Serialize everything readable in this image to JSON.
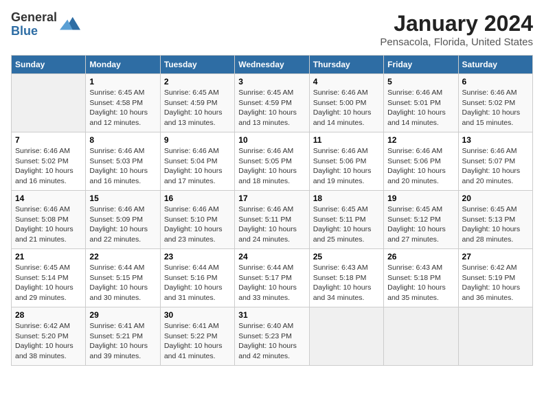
{
  "logo": {
    "general": "General",
    "blue": "Blue"
  },
  "title": "January 2024",
  "subtitle": "Pensacola, Florida, United States",
  "days_header": [
    "Sunday",
    "Monday",
    "Tuesday",
    "Wednesday",
    "Thursday",
    "Friday",
    "Saturday"
  ],
  "weeks": [
    [
      {
        "day": "",
        "content": ""
      },
      {
        "day": "1",
        "content": "Sunrise: 6:45 AM\nSunset: 4:58 PM\nDaylight: 10 hours\nand 12 minutes."
      },
      {
        "day": "2",
        "content": "Sunrise: 6:45 AM\nSunset: 4:59 PM\nDaylight: 10 hours\nand 13 minutes."
      },
      {
        "day": "3",
        "content": "Sunrise: 6:45 AM\nSunset: 4:59 PM\nDaylight: 10 hours\nand 13 minutes."
      },
      {
        "day": "4",
        "content": "Sunrise: 6:46 AM\nSunset: 5:00 PM\nDaylight: 10 hours\nand 14 minutes."
      },
      {
        "day": "5",
        "content": "Sunrise: 6:46 AM\nSunset: 5:01 PM\nDaylight: 10 hours\nand 14 minutes."
      },
      {
        "day": "6",
        "content": "Sunrise: 6:46 AM\nSunset: 5:02 PM\nDaylight: 10 hours\nand 15 minutes."
      }
    ],
    [
      {
        "day": "7",
        "content": "Sunrise: 6:46 AM\nSunset: 5:02 PM\nDaylight: 10 hours\nand 16 minutes."
      },
      {
        "day": "8",
        "content": "Sunrise: 6:46 AM\nSunset: 5:03 PM\nDaylight: 10 hours\nand 16 minutes."
      },
      {
        "day": "9",
        "content": "Sunrise: 6:46 AM\nSunset: 5:04 PM\nDaylight: 10 hours\nand 17 minutes."
      },
      {
        "day": "10",
        "content": "Sunrise: 6:46 AM\nSunset: 5:05 PM\nDaylight: 10 hours\nand 18 minutes."
      },
      {
        "day": "11",
        "content": "Sunrise: 6:46 AM\nSunset: 5:06 PM\nDaylight: 10 hours\nand 19 minutes."
      },
      {
        "day": "12",
        "content": "Sunrise: 6:46 AM\nSunset: 5:06 PM\nDaylight: 10 hours\nand 20 minutes."
      },
      {
        "day": "13",
        "content": "Sunrise: 6:46 AM\nSunset: 5:07 PM\nDaylight: 10 hours\nand 20 minutes."
      }
    ],
    [
      {
        "day": "14",
        "content": "Sunrise: 6:46 AM\nSunset: 5:08 PM\nDaylight: 10 hours\nand 21 minutes."
      },
      {
        "day": "15",
        "content": "Sunrise: 6:46 AM\nSunset: 5:09 PM\nDaylight: 10 hours\nand 22 minutes."
      },
      {
        "day": "16",
        "content": "Sunrise: 6:46 AM\nSunset: 5:10 PM\nDaylight: 10 hours\nand 23 minutes."
      },
      {
        "day": "17",
        "content": "Sunrise: 6:46 AM\nSunset: 5:11 PM\nDaylight: 10 hours\nand 24 minutes."
      },
      {
        "day": "18",
        "content": "Sunrise: 6:45 AM\nSunset: 5:11 PM\nDaylight: 10 hours\nand 25 minutes."
      },
      {
        "day": "19",
        "content": "Sunrise: 6:45 AM\nSunset: 5:12 PM\nDaylight: 10 hours\nand 27 minutes."
      },
      {
        "day": "20",
        "content": "Sunrise: 6:45 AM\nSunset: 5:13 PM\nDaylight: 10 hours\nand 28 minutes."
      }
    ],
    [
      {
        "day": "21",
        "content": "Sunrise: 6:45 AM\nSunset: 5:14 PM\nDaylight: 10 hours\nand 29 minutes."
      },
      {
        "day": "22",
        "content": "Sunrise: 6:44 AM\nSunset: 5:15 PM\nDaylight: 10 hours\nand 30 minutes."
      },
      {
        "day": "23",
        "content": "Sunrise: 6:44 AM\nSunset: 5:16 PM\nDaylight: 10 hours\nand 31 minutes."
      },
      {
        "day": "24",
        "content": "Sunrise: 6:44 AM\nSunset: 5:17 PM\nDaylight: 10 hours\nand 33 minutes."
      },
      {
        "day": "25",
        "content": "Sunrise: 6:43 AM\nSunset: 5:18 PM\nDaylight: 10 hours\nand 34 minutes."
      },
      {
        "day": "26",
        "content": "Sunrise: 6:43 AM\nSunset: 5:18 PM\nDaylight: 10 hours\nand 35 minutes."
      },
      {
        "day": "27",
        "content": "Sunrise: 6:42 AM\nSunset: 5:19 PM\nDaylight: 10 hours\nand 36 minutes."
      }
    ],
    [
      {
        "day": "28",
        "content": "Sunrise: 6:42 AM\nSunset: 5:20 PM\nDaylight: 10 hours\nand 38 minutes."
      },
      {
        "day": "29",
        "content": "Sunrise: 6:41 AM\nSunset: 5:21 PM\nDaylight: 10 hours\nand 39 minutes."
      },
      {
        "day": "30",
        "content": "Sunrise: 6:41 AM\nSunset: 5:22 PM\nDaylight: 10 hours\nand 41 minutes."
      },
      {
        "day": "31",
        "content": "Sunrise: 6:40 AM\nSunset: 5:23 PM\nDaylight: 10 hours\nand 42 minutes."
      },
      {
        "day": "",
        "content": ""
      },
      {
        "day": "",
        "content": ""
      },
      {
        "day": "",
        "content": ""
      }
    ]
  ]
}
